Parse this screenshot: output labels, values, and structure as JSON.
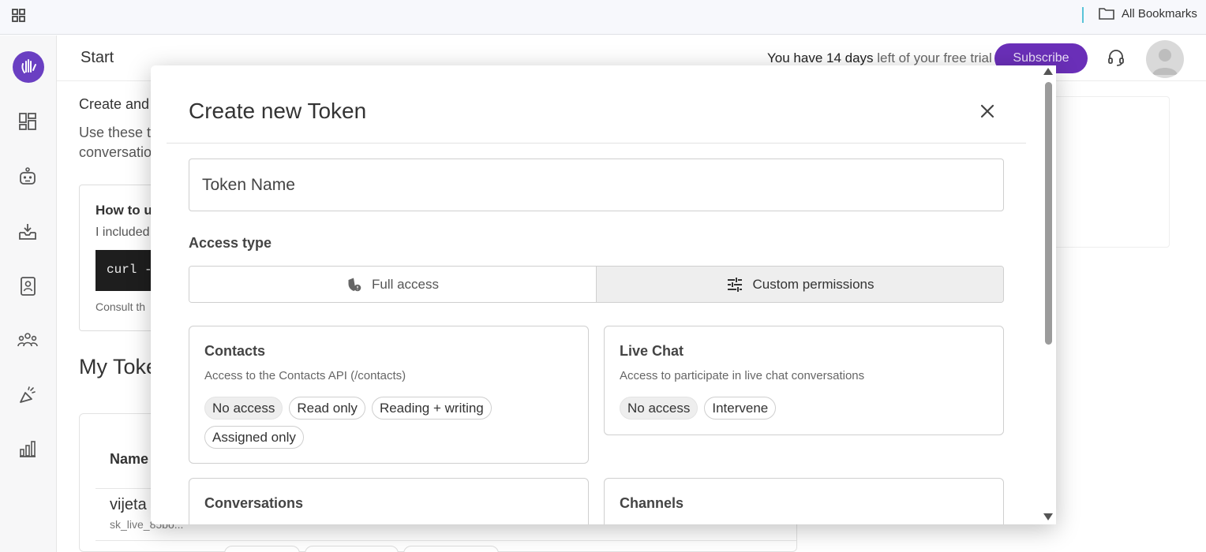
{
  "bookmarks_bar": {
    "folder_label": "All Bookmarks"
  },
  "topbar": {
    "page_title": "Start",
    "trial_prefix": "You have 14 days",
    "trial_suffix": " left of your free trial",
    "subscribe_label": "Subscribe"
  },
  "sidebar": {
    "items": [
      "dashboard-icon",
      "bot-icon",
      "inbox-icon",
      "contacts-book-icon",
      "team-icon",
      "campaign-icon",
      "analytics-icon"
    ]
  },
  "background": {
    "intro_line1": "Create and",
    "intro_line2a": "Use these t",
    "intro_line2b": "conversatio",
    "howto_heading": "How to u",
    "howto_text": "I included",
    "code_snippet": "curl -H",
    "consult_text": "Consult th",
    "tokens_heading": "My Toke",
    "table_header_name": "Name",
    "token_name": "vijeta",
    "token_key": "sk_live_85bo..."
  },
  "modal": {
    "title": "Create new Token",
    "token_name_placeholder": "Token Name",
    "access_type_label": "Access type",
    "access_options": [
      {
        "label": "Full access",
        "icon": "shield-icon",
        "selected": false
      },
      {
        "label": "Custom permissions",
        "icon": "sliders-icon",
        "selected": true
      }
    ],
    "permissions": {
      "contacts": {
        "title": "Contacts",
        "description": "Access to the Contacts API (/contacts)",
        "options": [
          "No access",
          "Read only",
          "Reading + writing",
          "Assigned only"
        ],
        "selected": "No access"
      },
      "live_chat": {
        "title": "Live Chat",
        "description": "Access to participate in live chat conversations",
        "options": [
          "No access",
          "Intervene"
        ],
        "selected": "No access"
      },
      "conversations": {
        "title": "Conversations"
      },
      "channels": {
        "title": "Channels"
      }
    }
  },
  "colors": {
    "brand": "#6a2fb8",
    "logo": "#6a3fc2",
    "selected_chip": "#eeeeee"
  }
}
